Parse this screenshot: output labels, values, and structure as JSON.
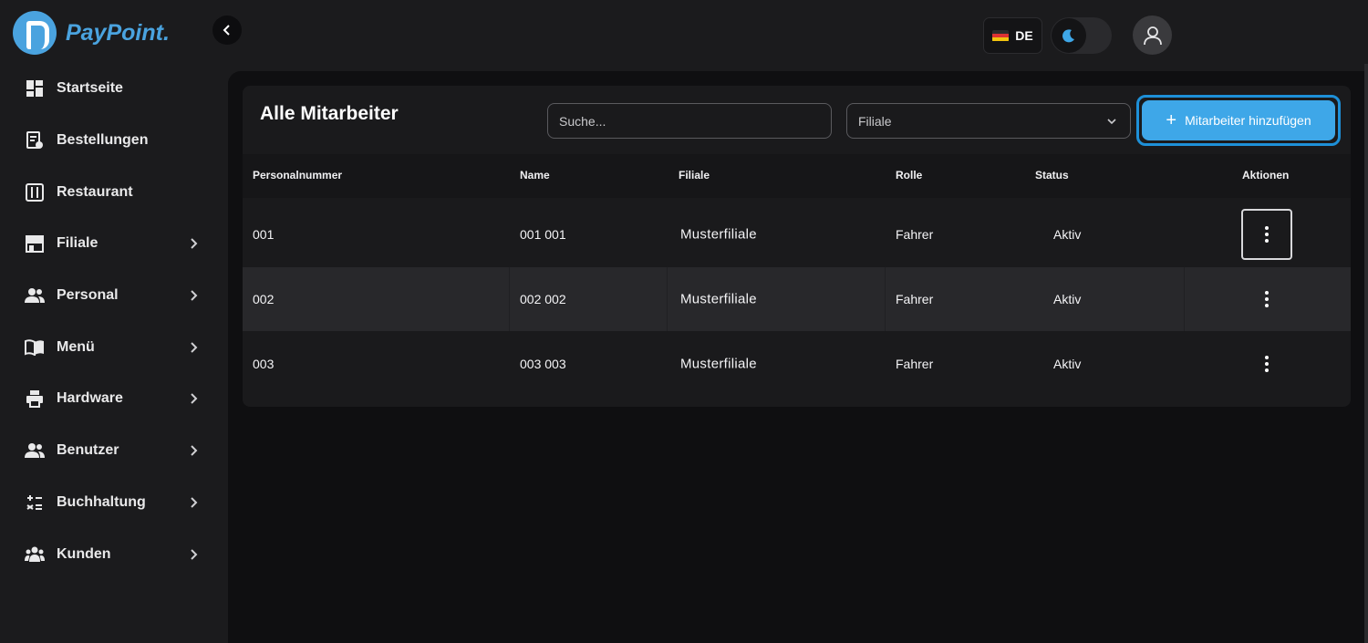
{
  "brand": {
    "name": "PayPoint."
  },
  "sidebar": {
    "items": [
      {
        "label": "Startseite",
        "icon": "dashboard-icon",
        "has_submenu": false
      },
      {
        "label": "Bestellungen",
        "icon": "orders-icon",
        "has_submenu": false
      },
      {
        "label": "Restaurant",
        "icon": "restaurant-icon",
        "has_submenu": false
      },
      {
        "label": "Filiale",
        "icon": "store-icon",
        "has_submenu": true
      },
      {
        "label": "Personal",
        "icon": "people-icon",
        "has_submenu": true
      },
      {
        "label": "Menü",
        "icon": "menu-book-icon",
        "has_submenu": true
      },
      {
        "label": "Hardware",
        "icon": "printer-icon",
        "has_submenu": true
      },
      {
        "label": "Benutzer",
        "icon": "users-icon",
        "has_submenu": true
      },
      {
        "label": "Buchhaltung",
        "icon": "accounting-icon",
        "has_submenu": true
      },
      {
        "label": "Kunden",
        "icon": "customers-icon",
        "has_submenu": true
      }
    ]
  },
  "header": {
    "language": "DE",
    "theme": "dark"
  },
  "main": {
    "title": "Alle Mitarbeiter",
    "search": {
      "placeholder": "Suche...",
      "value": ""
    },
    "filter": {
      "selected": "Filiale"
    },
    "add_button": {
      "label": "Mitarbeiter hinzufügen"
    },
    "table": {
      "columns": [
        "Personalnummer",
        "Name",
        "Filiale",
        "Rolle",
        "Status",
        "Aktionen"
      ],
      "rows": [
        {
          "personalnummer": "001",
          "name": "001 001",
          "filiale": "Musterfiliale",
          "rolle": "Fahrer",
          "status": "Aktiv"
        },
        {
          "personalnummer": "002",
          "name": "002 002",
          "filiale": "Musterfiliale",
          "rolle": "Fahrer",
          "status": "Aktiv"
        },
        {
          "personalnummer": "003",
          "name": "003 003",
          "filiale": "Musterfiliale",
          "rolle": "Fahrer",
          "status": "Aktiv"
        }
      ]
    }
  },
  "colors": {
    "accent": "#3ea7e8",
    "background": "#1b1b1d",
    "panel": "#1a1a1c"
  }
}
